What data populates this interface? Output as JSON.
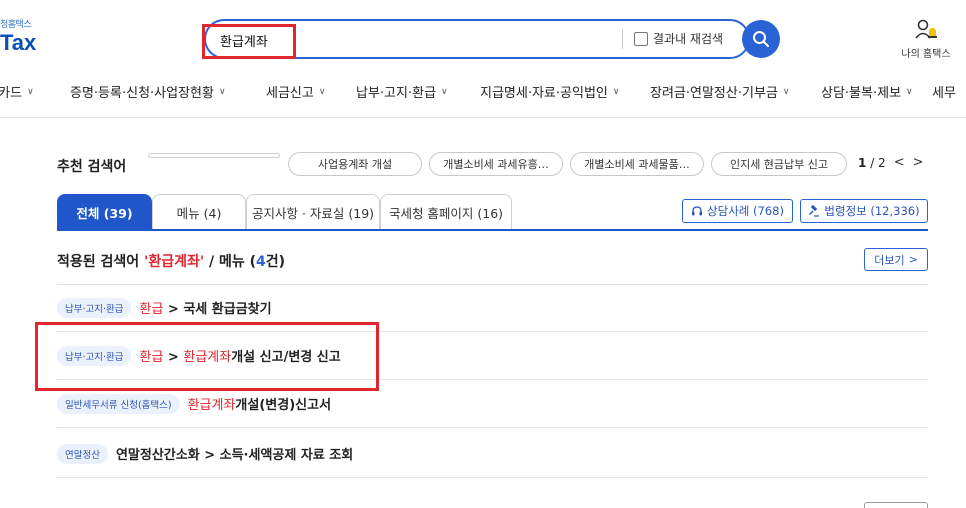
{
  "header": {
    "logo_sub": "청홈택스",
    "logo_main": "Tax",
    "search_value": "환급계좌",
    "research_label": "결과내 재검색",
    "my_home_label": "나의 홈택스"
  },
  "nav": {
    "items": [
      "·카드",
      "증명·등록·신청·사업장현황",
      "세금신고",
      "납부·고지·환급",
      "지급명세·자료·공익법인",
      "장려금·연말정산·기부금",
      "상담·불복·제보",
      "세무"
    ]
  },
  "recommended": {
    "title": "추천 검색어",
    "pills": [
      "사업용계좌 개설",
      "개별소비세 과세유흥…",
      "개별소비세 과세물품…",
      "인지세 현금납부 신고"
    ],
    "page_current": "1",
    "page_total": "/ 2"
  },
  "tabs": [
    "전체 (39)",
    "메뉴 (4)",
    "공지사항 · 자료실 (19)",
    "국세청 홈페이지 (16)"
  ],
  "extra_buttons": {
    "consult": "상담사례 (768)",
    "law": "법령정보 (12,336)"
  },
  "applied": {
    "prefix": "적용된 검색어 ",
    "keyword": "'환급계좌'",
    "mid": " / 메뉴 (",
    "count": "4",
    "suffix": "건)",
    "more_label": "더보기"
  },
  "results": [
    {
      "tag": "납부·고지·환급",
      "red": "환급",
      "rest": " > 국세 환급금찾기"
    },
    {
      "tag": "납부·고지·환급",
      "pre": "환급",
      "mid": " > ",
      "red": "환급계좌",
      "rest": "개설 신고/변경 신고"
    },
    {
      "tag": "일반세무서류 신청(홈택스)",
      "red": "환급계좌",
      "rest": "개설(변경)신고서"
    },
    {
      "tag": "연말정산",
      "rest": "연말정산간소화 > 소득·세액공제 자료 조회"
    }
  ],
  "colors": {
    "primary": "#2a63d6",
    "tab_active": "#1f56c9",
    "highlight": "#e0262f"
  }
}
